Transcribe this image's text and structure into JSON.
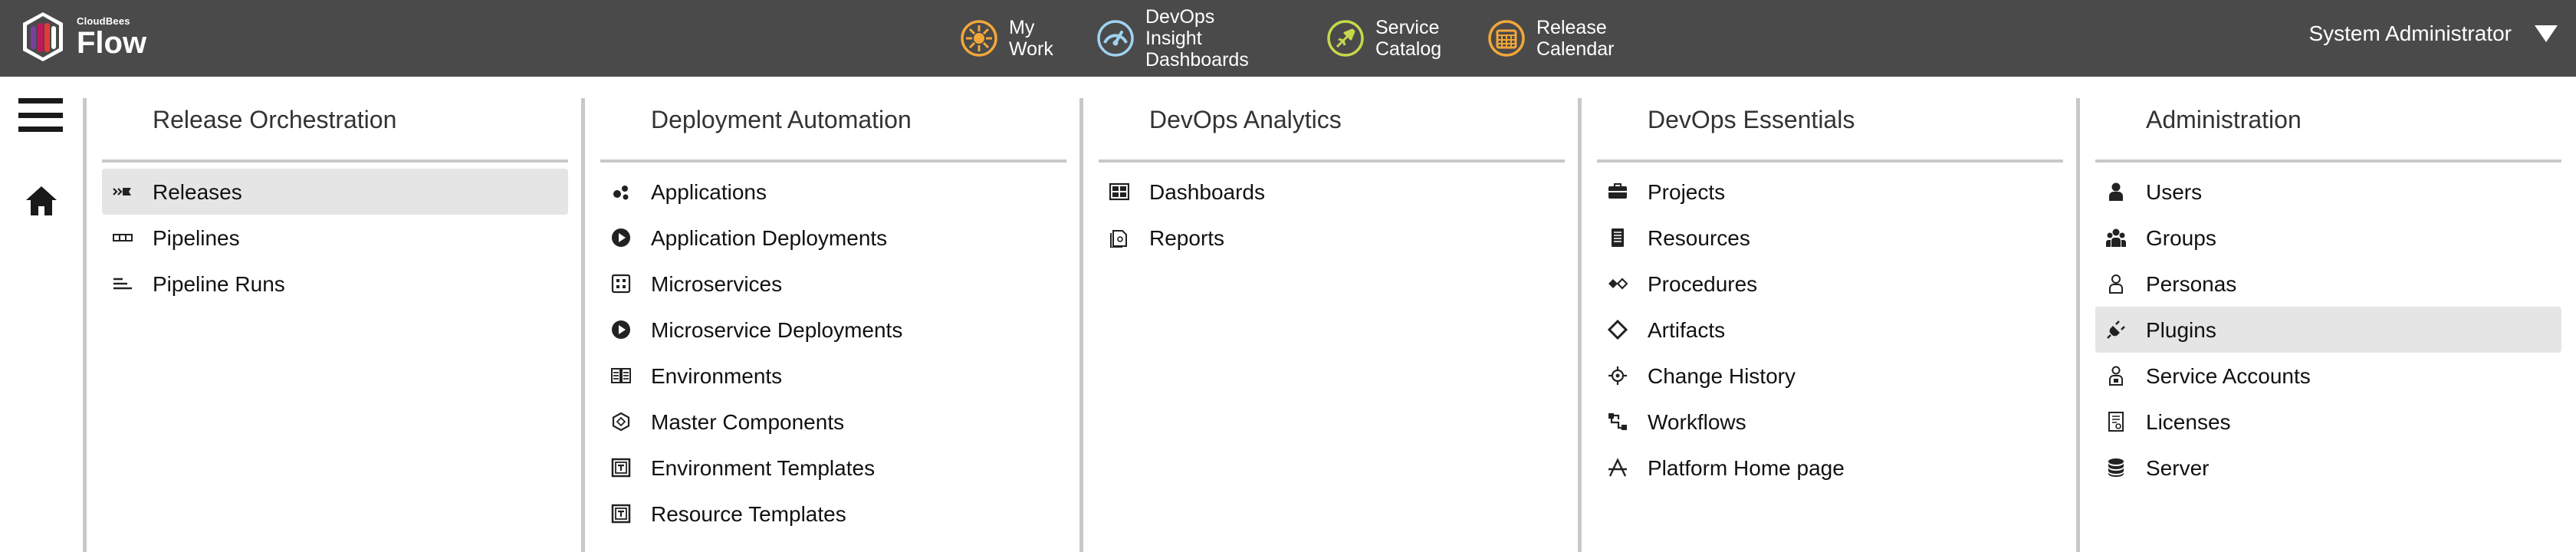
{
  "app": {
    "brand_small": "CloudBees",
    "brand_name": "Flow",
    "accent_color": "#f2a73b"
  },
  "topnav": [
    {
      "line1": "My",
      "line2": "Work",
      "icon": "my-work-icon"
    },
    {
      "line1": "DevOps Insight",
      "line2": "Dashboards",
      "icon": "dashboard-gauge-icon"
    },
    {
      "line1": "Service",
      "line2": "Catalog",
      "icon": "service-catalog-icon"
    },
    {
      "line1": "Release",
      "line2": "Calendar",
      "icon": "calendar-icon"
    }
  ],
  "user": {
    "name": "System Administrator"
  },
  "sections": [
    {
      "title": "Release Orchestration",
      "items": [
        {
          "label": "Releases",
          "icon": "releases-icon",
          "active": true
        },
        {
          "label": "Pipelines",
          "icon": "pipelines-icon",
          "active": false
        },
        {
          "label": "Pipeline Runs",
          "icon": "pipeline-runs-icon",
          "active": false
        }
      ]
    },
    {
      "title": "Deployment Automation",
      "items": [
        {
          "label": "Applications",
          "icon": "applications-icon",
          "active": false
        },
        {
          "label": "Application Deployments",
          "icon": "play-circle-icon",
          "active": false
        },
        {
          "label": "Microservices",
          "icon": "microservices-icon",
          "active": false
        },
        {
          "label": "Microservice Deployments",
          "icon": "play-circle-icon",
          "active": false
        },
        {
          "label": "Environments",
          "icon": "environments-icon",
          "active": false
        },
        {
          "label": "Master Components",
          "icon": "hexagon-icon",
          "active": false
        },
        {
          "label": "Environment Templates",
          "icon": "template-icon",
          "active": false
        },
        {
          "label": "Resource Templates",
          "icon": "template-icon",
          "active": false
        }
      ]
    },
    {
      "title": "DevOps Analytics",
      "items": [
        {
          "label": "Dashboards",
          "icon": "dashboards-grid-icon",
          "active": false
        },
        {
          "label": "Reports",
          "icon": "reports-icon",
          "active": false
        }
      ]
    },
    {
      "title": "DevOps Essentials",
      "items": [
        {
          "label": "Projects",
          "icon": "briefcase-icon",
          "active": false
        },
        {
          "label": "Resources",
          "icon": "server-rack-icon",
          "active": false
        },
        {
          "label": "Procedures",
          "icon": "procedures-icon",
          "active": false
        },
        {
          "label": "Artifacts",
          "icon": "diamond-icon",
          "active": false
        },
        {
          "label": "Change History",
          "icon": "crosshair-icon",
          "active": false
        },
        {
          "label": "Workflows",
          "icon": "workflows-icon",
          "active": false
        },
        {
          "label": "Platform Home page",
          "icon": "platform-icon",
          "active": false
        }
      ]
    },
    {
      "title": "Administration",
      "items": [
        {
          "label": "Users",
          "icon": "user-icon",
          "active": false
        },
        {
          "label": "Groups",
          "icon": "groups-icon",
          "active": false
        },
        {
          "label": "Personas",
          "icon": "persona-icon",
          "active": false
        },
        {
          "label": "Plugins",
          "icon": "plug-icon",
          "active": true
        },
        {
          "label": "Service Accounts",
          "icon": "service-account-icon",
          "active": false
        },
        {
          "label": "Licenses",
          "icon": "license-icon",
          "active": false
        },
        {
          "label": "Server",
          "icon": "database-icon",
          "active": false
        }
      ]
    }
  ]
}
